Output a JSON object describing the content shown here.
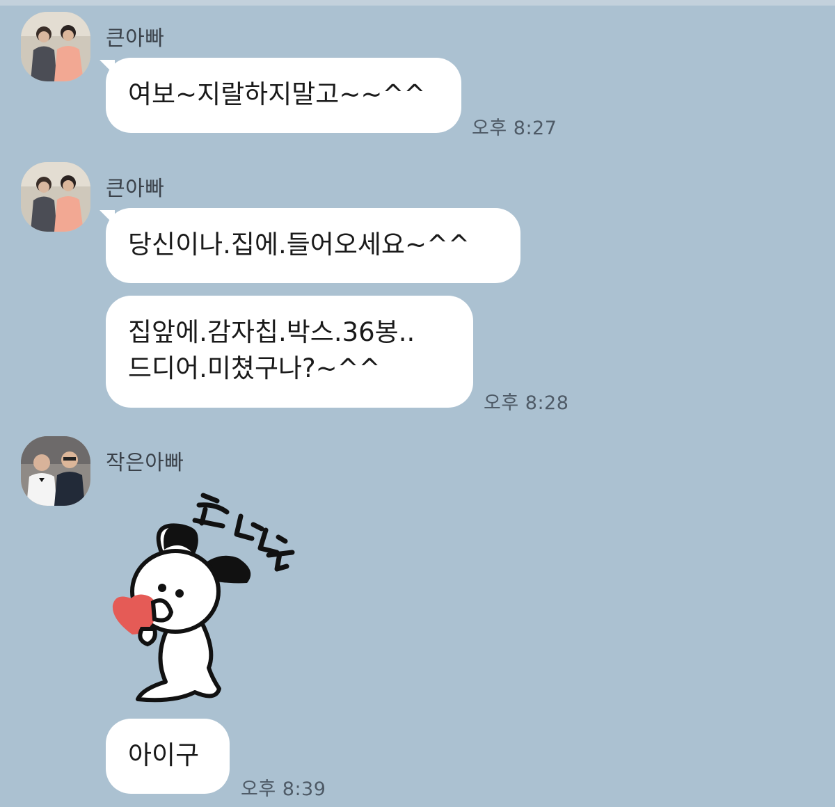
{
  "messages": [
    {
      "sender": "큰아빠",
      "text": "여보~지랄하지말고~~^^",
      "time": "오후 8:27"
    },
    {
      "sender": "큰아빠",
      "text": "당신이나.집에.들어오세요~^^"
    },
    {
      "text": "집앞에.감자칩.박스.36봉..\n드디어.미쳤구나?~^^",
      "time": "오후 8:28"
    },
    {
      "sender": "작은아빠",
      "sticker": "bunny-heart-sticker",
      "sticker_text": "토닥닥"
    },
    {
      "text": "아이구",
      "time": "오후 8:39"
    }
  ],
  "colors": {
    "background": "#abc1d1",
    "bubble": "#ffffff",
    "time": "#4e5a66"
  }
}
